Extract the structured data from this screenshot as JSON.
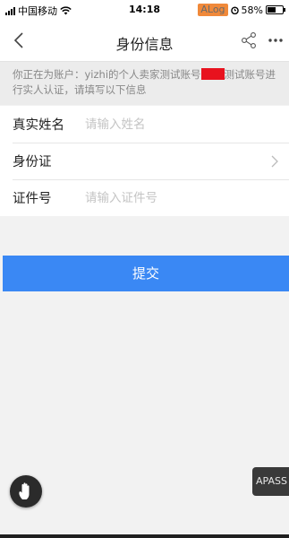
{
  "status_bar": {
    "carrier": "中国移动",
    "time": "14:18",
    "alog_badge": "ALog",
    "battery_percent_label": "58%",
    "battery_level": 0.58
  },
  "nav": {
    "title": "身份信息",
    "icons": [
      "back-arrow-icon",
      "share-icon",
      "more-icon"
    ]
  },
  "notice": {
    "text_before": "你正在为账户：yizhi的个人卖家测试账号",
    "text_after": "测试账号进行实人认证，请填写以下信息"
  },
  "form": {
    "real_name_label": "真实姓名",
    "real_name_placeholder": "请输入姓名",
    "real_name_value": "",
    "id_type_label": "身份证",
    "id_number_label": "证件号",
    "id_number_placeholder": "请输入证件号",
    "id_number_value": ""
  },
  "submit_label": "提交",
  "floating": {
    "apass_label": "APASS"
  },
  "colors": {
    "accent": "#3a88f4",
    "alog_badge": "#f0893a",
    "redaction": "#e8121e",
    "notice_bg": "#ececec",
    "page_bg": "#f2f2f2"
  }
}
